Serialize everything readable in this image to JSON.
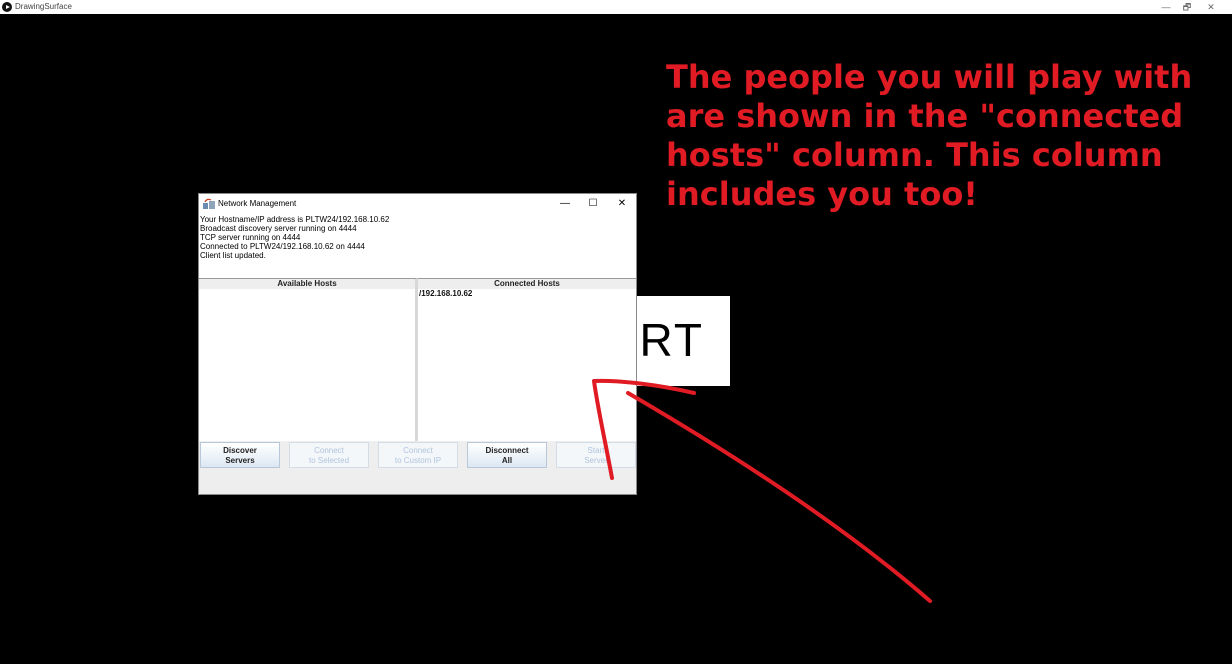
{
  "app": {
    "title": "DrawingSurface",
    "icons": [
      "play-icon"
    ],
    "controls": {
      "minimize": "—",
      "restore": "🗗",
      "close": "✕"
    }
  },
  "background_button": {
    "label": "RT"
  },
  "annotation": {
    "text": "The people you will play with are shown in the \"connected hosts\" column. This column includes you too!",
    "color": "#e01b24"
  },
  "dialog": {
    "title": "Network Management",
    "controls": {
      "minimize": "—",
      "maximize": "☐",
      "close": "✕"
    },
    "log": [
      "Your Hostname/IP address is PLTW24/192.168.10.62",
      "Broadcast discovery server running on 4444",
      "TCP server running on 4444",
      "Connected to PLTW24/192.168.10.62 on 4444",
      "Client list updated."
    ],
    "available_hosts": {
      "header": "Available Hosts",
      "items": []
    },
    "connected_hosts": {
      "header": "Connected Hosts",
      "items": [
        "/192.168.10.62"
      ]
    },
    "buttons": [
      {
        "line1": "Discover",
        "line2": "Servers",
        "enabled": true
      },
      {
        "line1": "Connect",
        "line2": "to Selected",
        "enabled": false
      },
      {
        "line1": "Connect",
        "line2": "to Custom IP",
        "enabled": false
      },
      {
        "line1": "Disconnect",
        "line2": "All",
        "enabled": true
      },
      {
        "line1": "Start",
        "line2": "Server",
        "enabled": false
      }
    ]
  }
}
